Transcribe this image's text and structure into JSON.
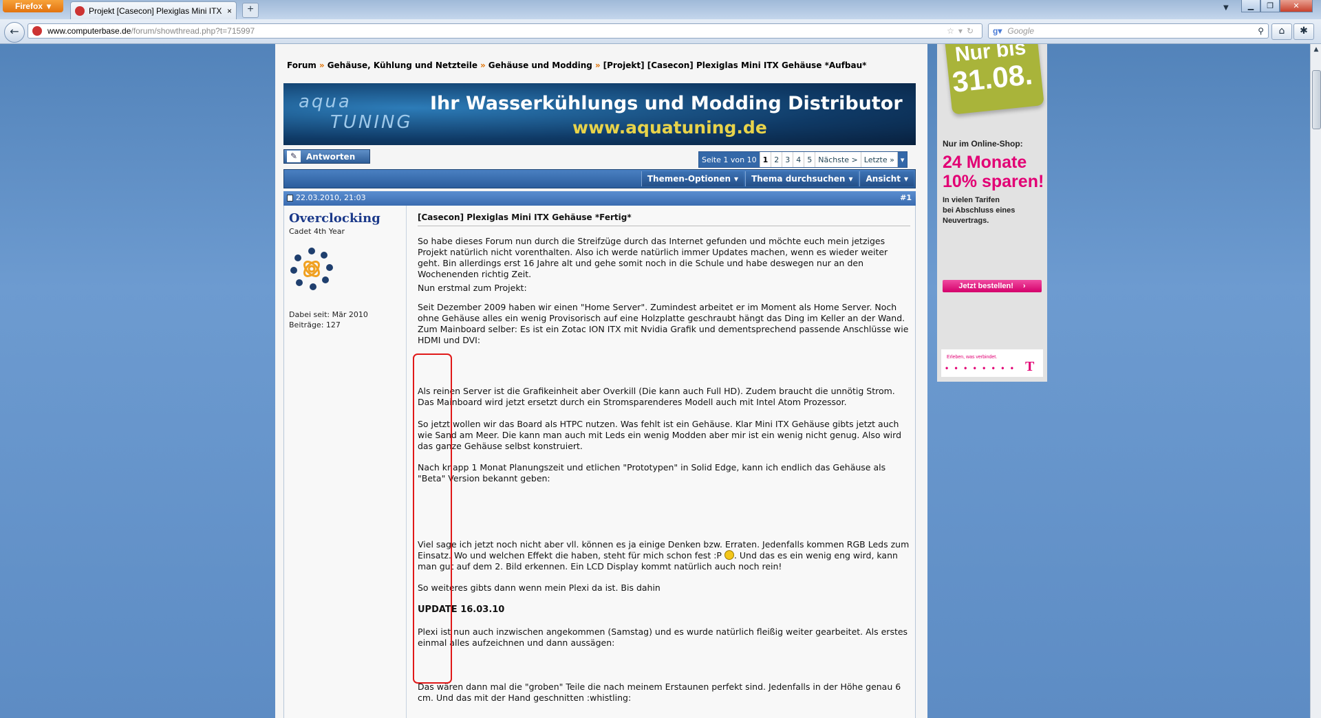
{
  "browser": {
    "menu_label": "Firefox",
    "tab_title": "Projekt [Casecon] Plexiglas Mini ITX Geh...",
    "new_tab_symbol": "+",
    "url_domain": "www.computerbase.de",
    "url_path": "/forum/showthread.php?t=715997",
    "search_placeholder": "Google"
  },
  "breadcrumb": {
    "items": [
      "Forum",
      "Gehäuse, Kühlung und Netzteile",
      "Gehäuse und Modding",
      "[Projekt] [Casecon] Plexiglas Mini ITX Gehäuse *Aufbau*"
    ],
    "separator": "»"
  },
  "banner": {
    "logo_top": "aqua",
    "logo_bottom": "TUNING",
    "headline": "Ihr Wasserkühlungs und Modding Distributor",
    "url": "www.aquatuning.de"
  },
  "toolbar": {
    "reply_label": "Antworten"
  },
  "pagination": {
    "label": "Seite 1 von 10",
    "pages": [
      "1",
      "2",
      "3",
      "4",
      "5"
    ],
    "current": "1",
    "next": "Nächste >",
    "last": "Letzte »"
  },
  "thread_menu": {
    "options": "Themen-Optionen",
    "search": "Thema durchsuchen",
    "view": "Ansicht"
  },
  "post": {
    "date": "22.03.2010, 21:03",
    "number": "#1",
    "username": "Overclocking",
    "user_title": "Cadet 4th Year",
    "joined": "Dabei seit: Mär 2010",
    "post_count": "Beiträge: 127",
    "title": "[Casecon] Plexiglas Mini ITX Gehäuse *Fertig*",
    "paragraphs": {
      "p1": "So habe dieses Forum nun durch die Streifzüge durch das Internet gefunden und möchte euch mein jetziges Projekt natürlich nicht vorenthalten. Also ich werde natürlich immer Updates machen, wenn es wieder weiter geht. Bin allerdings erst 16 Jahre alt und gehe somit noch in die Schule und habe deswegen nur an den Wochenenden richtig Zeit.",
      "p2": "Nun erstmal zum Projekt:",
      "p3": "Seit Dezember 2009 haben wir einen \"Home Server\". Zumindest arbeitet er im Moment als Home Server. Noch ohne Gehäuse alles ein wenig Provisorisch auf eine Holzplatte geschraubt hängt das Ding im Keller an der Wand. Zum Mainboard selber: Es ist ein Zotac ION ITX mit Nvidia Grafik und dementsprechend passende Anschlüsse wie HDMI und DVI:",
      "p4": "Als reinen Server ist die Grafikeinheit aber Overkill (Die kann auch Full HD). Zudem braucht die unnötig Strom. Das Mainboard wird jetzt ersetzt durch ein Stromsparenderes Modell auch mit Intel Atom Prozessor.",
      "p5": "So jetzt wollen wir das Board als HTPC nutzen. Was fehlt ist ein Gehäuse. Klar Mini ITX Gehäuse gibts jetzt auch wie Sand am Meer. Die kann man auch mit Leds ein wenig Modden aber mir ist ein wenig nicht genug. Also wird das ganze Gehäuse selbst konstruiert.",
      "p6": "Nach knapp 1 Monat Planungszeit und etlichen \"Prototypen\" in Solid Edge, kann ich endlich das Gehäuse als \"Beta\" Version bekannt geben:",
      "p7a": "Viel sage ich jetzt noch nicht aber vll. können es ja einige Denken bzw. Erraten. Jedenfalls kommen RGB Leds zum Einsatz. Wo und welchen Effekt die haben, steht für mich schon fest :P ",
      "p7b": ". Und das es ein wenig eng wird, kann man gut auf dem 2. Bild erkennen. Ein LCD Display kommt natürlich auch noch rein!",
      "p8": "So weiteres gibts dann wenn mein Plexi da ist. Bis dahin",
      "update": "UPDATE 16.03.10",
      "p9": "Plexi ist nun auch inzwischen angekommen (Samstag) und es wurde natürlich fleißig weiter gearbeitet. Als erstes einmal alles aufzeichnen und dann aussägen:",
      "p10": "Das wären dann mal die \"groben\" Teile die nach meinem Erstaunen perfekt sind. Jedenfalls in der Höhe genau 6 cm. Und das mit der Hand geschnitten :whistling:"
    }
  },
  "ad": {
    "badge_line1": "Nur bis",
    "badge_line2": "31.08.",
    "shop": "Nur im Online-Shop:",
    "headline1": "24 Monate",
    "headline2": "10% sparen!",
    "line1": "In vielen Tarifen",
    "line2": "bei Abschluss eines",
    "line3": "Neuvertrags.",
    "cta": "Jetzt bestellen!",
    "slogan": "Erleben, was verbindet.",
    "dots": "• • • • • • • •",
    "brand_letter": "T"
  },
  "colors": {
    "link_blue": "#1c3a8a",
    "accent_orange": "#e07000",
    "header_blue": "#3468a8",
    "telekom_magenta": "#e20074",
    "annotation_red": "#e01818"
  }
}
